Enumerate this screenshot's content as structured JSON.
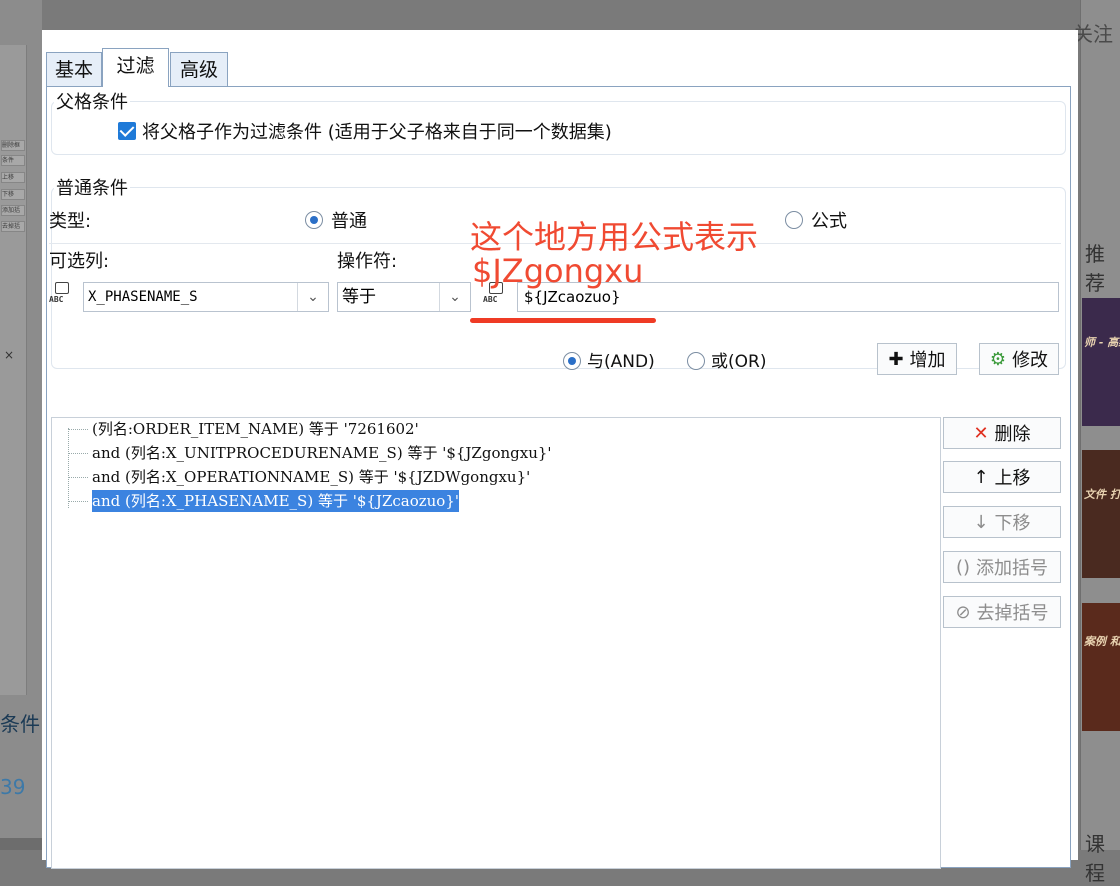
{
  "background": {
    "left_small_items": [
      "删除框",
      "条件",
      "上移",
      "下移",
      "添加括号",
      "去掉括号"
    ],
    "left_close": "×",
    "left_text_condition": "条件",
    "left_text_number": "39",
    "right_text_follow": "关注",
    "right_text_recommend": "推荐",
    "right_text_course": "课程",
    "ads": [
      "师 - 高级",
      "文件 打印行",
      "案例 和Fine"
    ]
  },
  "dialog": {
    "tabs": {
      "basic": "基本",
      "filter": "过滤",
      "advanced": "高级"
    },
    "parent_group": {
      "legend": "父格条件",
      "checkbox_label": "将父格子作为过滤条件 (适用于父子格来自于同一个数据集)",
      "checked": true
    },
    "normal_group": {
      "legend": "普通条件",
      "type_label": "类型:",
      "type_options": {
        "normal": "普通",
        "formula": "公式"
      },
      "type_selected": "普通",
      "column_label": "可选列:",
      "column_value": "X_PHASENAME_S",
      "operator_label": "操作符:",
      "operator_value": "等于",
      "value_text": "${JZcaozuo}"
    },
    "logic": {
      "and_label": "与(AND)",
      "or_label": "或(OR)",
      "selected": "AND"
    },
    "buttons": {
      "add": "增加",
      "modify": "修改",
      "delete": "删除",
      "move_up": "上移",
      "move_down": "下移",
      "add_bracket": "添加括号",
      "remove_bracket": "去掉括号"
    },
    "conditions": [
      "(列名:ORDER_ITEM_NAME) 等于 '7261602'",
      "and (列名:X_UNITPROCEDURENAME_S) 等于 '${JZgongxu}'",
      "and (列名:X_OPERATIONNAME_S) 等于 '${JZDWgongxu}'",
      "and (列名:X_PHASENAME_S) 等于 '${JZcaozuo}'"
    ],
    "selected_condition_index": 3
  },
  "annotation": {
    "line1": "这个地方用公式表示",
    "line2": "$JZgongxu",
    "color": "#f04a32"
  }
}
